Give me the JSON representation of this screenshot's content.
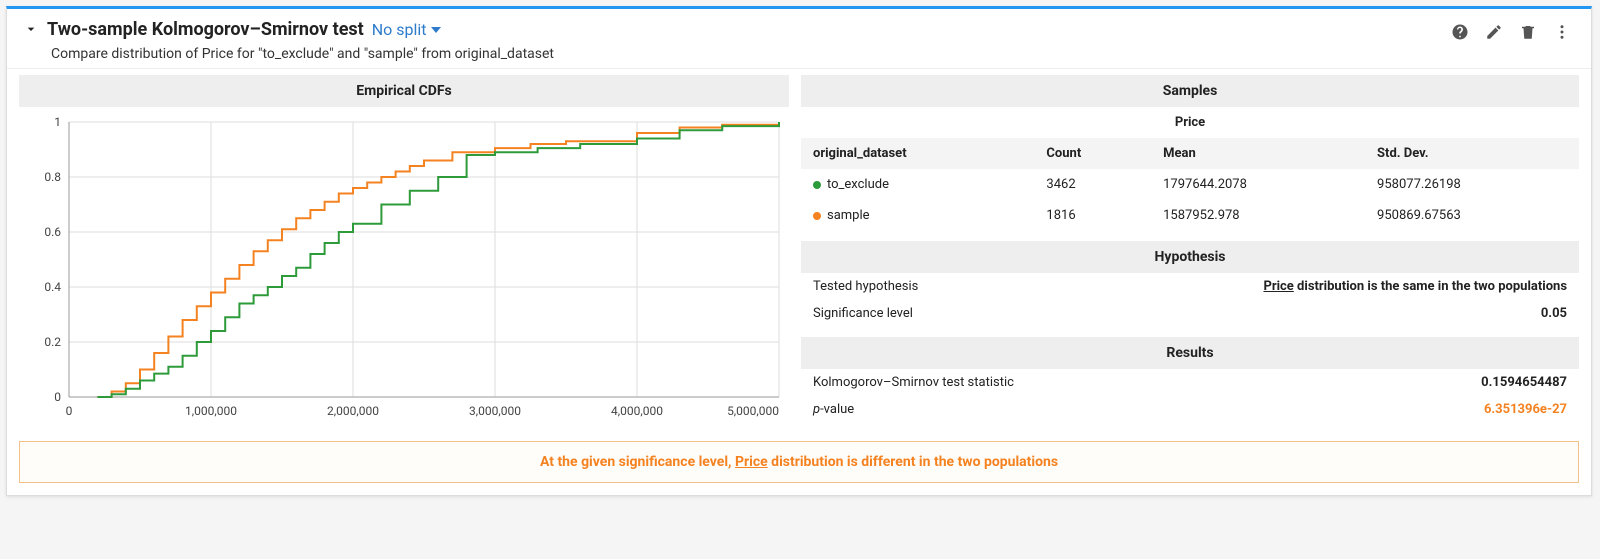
{
  "header": {
    "title": "Two-sample Kolmogorov–Smirnov test",
    "split_label": "No split",
    "subtitle": "Compare distribution of Price for \"to_exclude\" and \"sample\" from original_dataset"
  },
  "chart_panel": {
    "title": "Empirical CDFs"
  },
  "samples_panel": {
    "title": "Samples",
    "variable": "Price",
    "group_col": "original_dataset",
    "columns": [
      "Count",
      "Mean",
      "Std. Dev."
    ],
    "rows": [
      {
        "label": "to_exclude",
        "color": "green",
        "count": "3462",
        "mean": "1797644.2078",
        "std": "958077.26198"
      },
      {
        "label": "sample",
        "color": "orange",
        "count": "1816",
        "mean": "1587952.978",
        "std": "950869.67563"
      }
    ]
  },
  "hypothesis_panel": {
    "title": "Hypothesis",
    "tested_label": "Tested hypothesis",
    "tested_value_prefix": "Price",
    "tested_value_suffix": " distribution is the same in the two populations",
    "sig_label": "Significance level",
    "sig_value": "0.05"
  },
  "results_panel": {
    "title": "Results",
    "stat_label": "Kolmogorov–Smirnov test statistic",
    "stat_value": "0.1594654487",
    "p_label_prefix": "p",
    "p_label_suffix": "-value",
    "p_value": "6.351396e-27"
  },
  "conclusion": {
    "prefix": "At the given significance level, ",
    "underline": "Price",
    "suffix": " distribution is different in the two populations"
  },
  "chart_data": {
    "type": "line",
    "title": "Empirical CDFs",
    "xlabel": "",
    "ylabel": "",
    "xlim": [
      0,
      5000000
    ],
    "ylim": [
      0,
      1
    ],
    "xticks": [
      0,
      1000000,
      2000000,
      3000000,
      4000000,
      5000000
    ],
    "xtick_labels": [
      "0",
      "1,000,000",
      "2,000,000",
      "3,000,000",
      "4,000,000",
      "5,000,000"
    ],
    "yticks": [
      0,
      0.2,
      0.4,
      0.6,
      0.8,
      1
    ],
    "grid": true,
    "legend": [
      "to_exclude",
      "sample"
    ],
    "colors": {
      "to_exclude": "#2e9b3a",
      "sample": "#f58220"
    },
    "series": [
      {
        "name": "sample",
        "x": [
          200000,
          300000,
          400000,
          500000,
          600000,
          700000,
          800000,
          900000,
          1000000,
          1100000,
          1200000,
          1300000,
          1400000,
          1500000,
          1600000,
          1700000,
          1800000,
          1900000,
          2000000,
          2100000,
          2200000,
          2300000,
          2400000,
          2500000,
          2700000,
          3000000,
          3250000,
          3500000,
          4000000,
          4300000,
          4600000,
          5000000
        ],
        "y": [
          0.0,
          0.02,
          0.05,
          0.1,
          0.16,
          0.22,
          0.28,
          0.33,
          0.38,
          0.43,
          0.48,
          0.53,
          0.57,
          0.61,
          0.65,
          0.68,
          0.71,
          0.74,
          0.76,
          0.78,
          0.8,
          0.82,
          0.84,
          0.86,
          0.89,
          0.905,
          0.92,
          0.93,
          0.96,
          0.98,
          0.99,
          1.0
        ]
      },
      {
        "name": "to_exclude",
        "x": [
          200000,
          300000,
          400000,
          500000,
          600000,
          700000,
          800000,
          900000,
          1000000,
          1100000,
          1200000,
          1300000,
          1400000,
          1500000,
          1600000,
          1700000,
          1800000,
          1900000,
          2000000,
          2200000,
          2400000,
          2600000,
          2800000,
          3000000,
          3300000,
          3600000,
          4000000,
          4300000,
          4600000,
          5000000
        ],
        "y": [
          0.0,
          0.01,
          0.03,
          0.06,
          0.085,
          0.11,
          0.15,
          0.2,
          0.24,
          0.29,
          0.34,
          0.37,
          0.4,
          0.44,
          0.47,
          0.52,
          0.56,
          0.6,
          0.63,
          0.7,
          0.75,
          0.8,
          0.88,
          0.89,
          0.905,
          0.92,
          0.94,
          0.97,
          0.985,
          1.0
        ]
      }
    ]
  }
}
